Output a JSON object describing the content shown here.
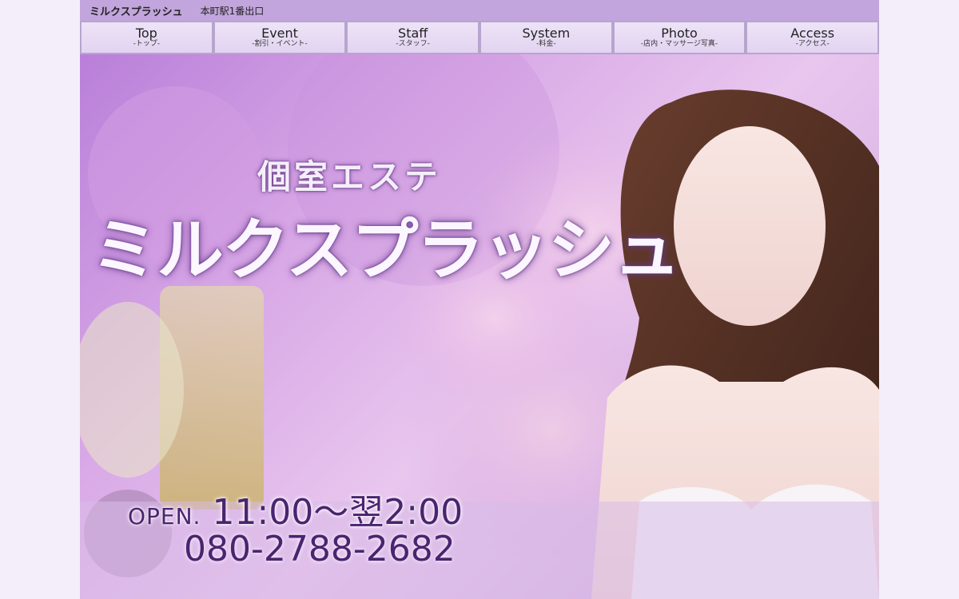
{
  "header": {
    "shop_name": "ミルクスプラッシュ",
    "station": "本町駅1番出口"
  },
  "nav": [
    {
      "label": "Top",
      "sub": "-トップ-"
    },
    {
      "label": "Event",
      "sub": "-割引・イベント-"
    },
    {
      "label": "Staff",
      "sub": "-スタッフ-"
    },
    {
      "label": "System",
      "sub": "-料金-"
    },
    {
      "label": "Photo",
      "sub": "-店内・マッサージ写真-"
    },
    {
      "label": "Access",
      "sub": "-アクセス-"
    }
  ],
  "hero": {
    "tagline": "個室エステ",
    "brand": "ミルクスプラッシュ",
    "open_label": "OPEN.",
    "open_time": "11:00〜翌2:00",
    "phone": "080-2788-2682"
  },
  "colors": {
    "topbar": "#c2a5dc",
    "hero_purple": "#c79bd8",
    "text_dark_purple": "#4a2470"
  }
}
